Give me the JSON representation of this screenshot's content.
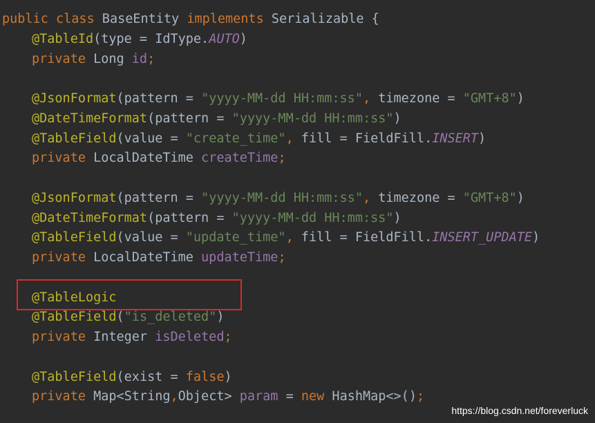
{
  "lines": [
    {
      "t0": "public",
      "t1": " ",
      "t2": "class",
      "t3": " BaseEntity ",
      "t4": "implements",
      "t5": " Serializable {"
    },
    {
      "t0": "@TableId",
      "t1": "(type = IdType.",
      "t2": "AUTO",
      "t3": ")"
    },
    {
      "t0": "private",
      "t1": " Long ",
      "t2": "id",
      "t3": ";"
    },
    {},
    {
      "t0": "@JsonFormat",
      "t1": "(pattern = ",
      "t2": "\"yyyy-MM-dd HH:mm:ss\"",
      "t3": ", ",
      "t4": "timezone = ",
      "t5": "\"GMT+8\"",
      "t6": ")"
    },
    {
      "t0": "@DateTimeFormat",
      "t1": "(pattern = ",
      "t2": "\"yyyy-MM-dd HH:mm:ss\"",
      "t3": ")"
    },
    {
      "t0": "@TableField",
      "t1": "(value = ",
      "t2": "\"create_time\"",
      "t3": ", ",
      "t4": "fill = FieldFill.",
      "t5": "INSERT",
      "t6": ")"
    },
    {
      "t0": "private",
      "t1": " LocalDateTime ",
      "t2": "createTime",
      "t3": ";"
    },
    {},
    {
      "t0": "@JsonFormat",
      "t1": "(pattern = ",
      "t2": "\"yyyy-MM-dd HH:mm:ss\"",
      "t3": ", ",
      "t4": "timezone = ",
      "t5": "\"GMT+8\"",
      "t6": ")"
    },
    {
      "t0": "@DateTimeFormat",
      "t1": "(pattern = ",
      "t2": "\"yyyy-MM-dd HH:mm:ss\"",
      "t3": ")"
    },
    {
      "t0": "@TableField",
      "t1": "(value = ",
      "t2": "\"update_time\"",
      "t3": ", ",
      "t4": "fill = FieldFill.",
      "t5": "INSERT_UPDATE",
      "t6": ")"
    },
    {
      "t0": "private",
      "t1": " LocalDateTime ",
      "t2": "updateTime",
      "t3": ";"
    },
    {},
    {
      "t0": "@TableLogic"
    },
    {
      "t0": "@TableField",
      "t1": "(",
      "t2": "\"is_deleted\"",
      "t3": ")"
    },
    {
      "t0": "private",
      "t1": " Integer ",
      "t2": "isDeleted",
      "t3": ";"
    },
    {},
    {
      "t0": "@TableField",
      "t1": "(exist = ",
      "t2": "false",
      "t3": ")"
    },
    {
      "t0": "private",
      "t1": " Map<String",
      "t2": ",",
      "t3": "Object> ",
      "t4": "param",
      "t5": " = ",
      "t6": "new",
      "t7": " HashMap<>()",
      "t8": ";"
    }
  ],
  "watermark": "https://blog.csdn.net/foreverluck",
  "colors": {
    "background": "#2b2b2b",
    "keyword": "#cc7832",
    "annotation": "#bbb529",
    "string": "#6a8759",
    "field": "#9876aa",
    "default": "#a9b7c6",
    "highlight_box": "#e0262b"
  }
}
